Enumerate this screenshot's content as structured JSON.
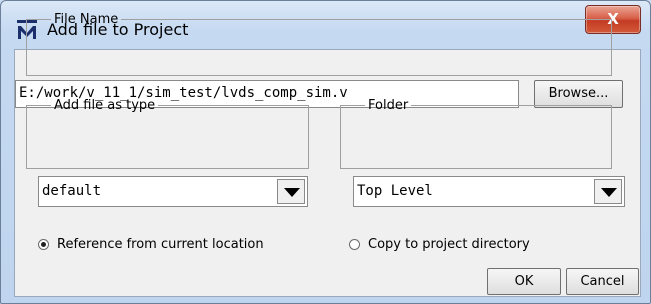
{
  "window": {
    "title": "Add file to Project",
    "close_label": "X",
    "icon": "modelsim-m-icon",
    "accent_close": "#c94a35"
  },
  "file_name": {
    "group_label": "File Name",
    "path_value": "E:/work/v_11_1/sim_test/lvds_comp_sim.v",
    "browse_label": "Browse..."
  },
  "file_type": {
    "group_label": "Add file as type",
    "selected": "default"
  },
  "folder": {
    "group_label": "Folder",
    "selected": "Top Level"
  },
  "location_options": [
    {
      "label": "Reference from current location",
      "selected": true
    },
    {
      "label": "Copy to project directory",
      "selected": false
    }
  ],
  "buttons": {
    "ok_label": "OK",
    "cancel_label": "Cancel"
  }
}
